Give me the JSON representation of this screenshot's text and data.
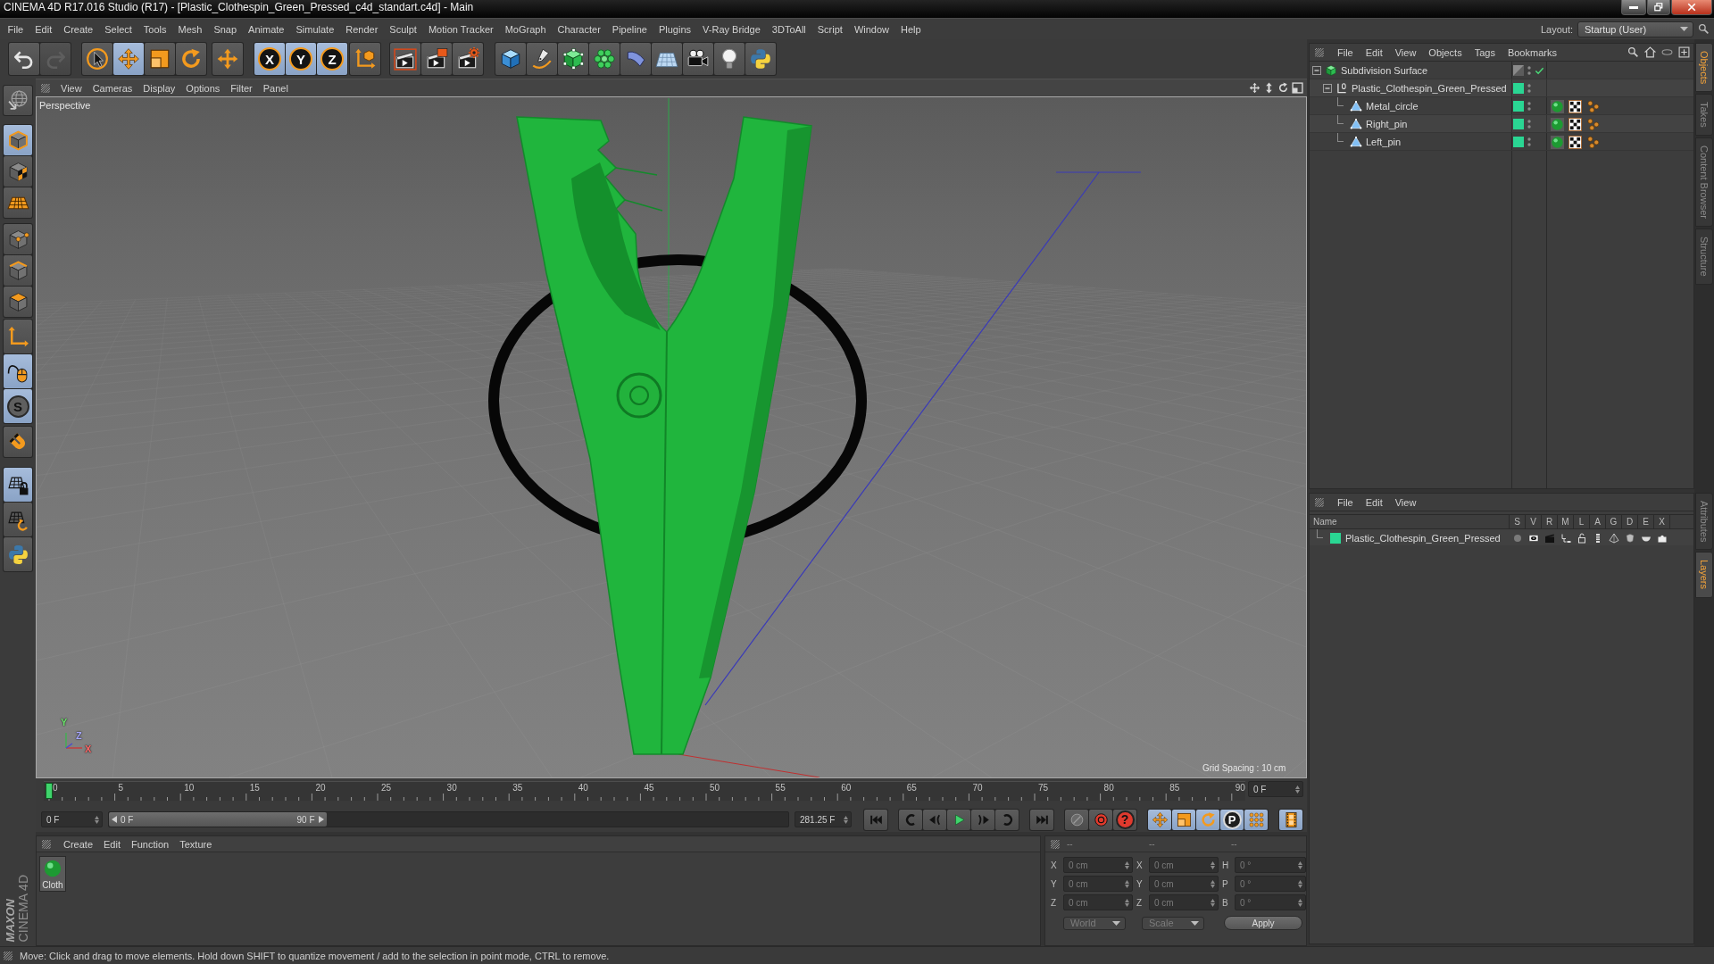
{
  "window": {
    "title": "CINEMA 4D R17.016 Studio (R17) - [Plastic_Clothespin_Green_Pressed_c4d_standart.c4d] - Main"
  },
  "menu_bar": {
    "items": [
      "File",
      "Edit",
      "Create",
      "Select",
      "Tools",
      "Mesh",
      "Snap",
      "Animate",
      "Simulate",
      "Render",
      "Sculpt",
      "Motion Tracker",
      "MoGraph",
      "Character",
      "Pipeline",
      "Plugins",
      "V-Ray Bridge",
      "3DToAll",
      "Script",
      "Window",
      "Help"
    ],
    "layout_label": "Layout:",
    "layout_value": "Startup (User)"
  },
  "toolbar": [
    [
      {
        "kind": "undo",
        "on": false,
        "disabled": false
      },
      {
        "kind": "redo",
        "on": false,
        "disabled": true
      }
    ],
    [
      {
        "kind": "select",
        "on": false,
        "disabled": false
      },
      {
        "kind": "move",
        "on": true,
        "disabled": false
      },
      {
        "kind": "scale",
        "on": false,
        "disabled": false
      },
      {
        "kind": "rotate",
        "on": false,
        "disabled": false
      }
    ],
    [
      {
        "kind": "transform",
        "on": false,
        "disabled": false
      }
    ],
    [
      {
        "kind": "axis",
        "label": "X",
        "on": true,
        "disabled": false
      },
      {
        "kind": "axis",
        "label": "Y",
        "on": true,
        "disabled": false
      },
      {
        "kind": "axis",
        "label": "Z",
        "on": true,
        "disabled": false
      }
    ],
    [
      {
        "kind": "coords",
        "on": false,
        "disabled": false
      }
    ],
    [
      {
        "kind": "render-view",
        "on": false,
        "disabled": false
      },
      {
        "kind": "render-picture",
        "on": false,
        "disabled": false
      },
      {
        "kind": "render-settings",
        "on": false,
        "disabled": false
      }
    ],
    [
      {
        "kind": "cube",
        "on": false,
        "disabled": false
      },
      {
        "kind": "pen",
        "on": false,
        "disabled": false
      },
      {
        "kind": "subdivision",
        "on": false,
        "disabled": false
      },
      {
        "kind": "cloner",
        "on": false,
        "disabled": false
      },
      {
        "kind": "deformer",
        "on": false,
        "disabled": false
      },
      {
        "kind": "floor",
        "on": false,
        "disabled": false
      },
      {
        "kind": "camera",
        "on": false,
        "disabled": false
      },
      {
        "kind": "light",
        "on": false,
        "disabled": false
      },
      {
        "kind": "python",
        "on": false,
        "disabled": false
      }
    ]
  ],
  "tool_strip": [
    [
      {
        "kind": "make-editable",
        "on": false
      }
    ],
    [
      {
        "kind": "model",
        "on": true
      },
      {
        "kind": "texture",
        "on": false
      },
      {
        "kind": "workplane",
        "on": false
      }
    ],
    [
      {
        "kind": "points",
        "on": false
      },
      {
        "kind": "edges",
        "on": false
      },
      {
        "kind": "polygons",
        "on": false
      }
    ],
    [
      {
        "kind": "axis-mode",
        "on": false
      },
      {
        "kind": "tweak",
        "on": true
      },
      {
        "kind": "snap",
        "label": "S",
        "on": true
      }
    ],
    [
      {
        "kind": "magnet",
        "on": false
      }
    ],
    [
      {
        "kind": "workplane-lock",
        "on": true
      },
      {
        "kind": "grid-rotate",
        "on": false
      },
      {
        "kind": "python",
        "on": false
      }
    ]
  ],
  "logo": {
    "brand": "MAXON",
    "product": "CINEMA 4D"
  },
  "viewport": {
    "menu": [
      "View",
      "Cameras",
      "Display",
      "Options",
      "Filter",
      "Panel"
    ],
    "camera": "Perspective",
    "grid_spacing": "Grid Spacing : 10 cm",
    "axes": [
      {
        "label": "Y",
        "color": "#6ee46e"
      },
      {
        "label": "Z",
        "color": "#a8a8ff"
      },
      {
        "label": "X",
        "color": "#ff6a6a"
      }
    ]
  },
  "timeline": {
    "ticks": [
      "0",
      "5",
      "10",
      "15",
      "20",
      "25",
      "30",
      "35",
      "40",
      "45",
      "50",
      "55",
      "60",
      "65",
      "70",
      "75",
      "80",
      "85",
      "90"
    ],
    "level": 0,
    "frame": "0 F",
    "start": "0 F",
    "range": {
      "from": "0 F",
      "to": "90 F",
      "level": 0.32
    },
    "end": "281.25 F",
    "transport": [
      [
        {
          "kind": "start",
          "on": false
        }
      ],
      [
        {
          "kind": "prev-key",
          "on": false
        },
        {
          "kind": "prev-frame",
          "on": false
        },
        {
          "kind": "play",
          "on": false
        },
        {
          "kind": "next-frame",
          "on": false
        },
        {
          "kind": "next-key",
          "on": false
        }
      ],
      [
        {
          "kind": "end",
          "on": false
        }
      ],
      [
        {
          "kind": "record",
          "on": false
        },
        {
          "kind": "autokey",
          "on": false
        },
        {
          "kind": "help",
          "label": "?",
          "on": false
        }
      ],
      [
        {
          "kind": "key-move",
          "on": true
        },
        {
          "kind": "key-scale",
          "on": true
        },
        {
          "kind": "key-rotate",
          "on": true
        },
        {
          "kind": "key-param",
          "label": "P",
          "on": true
        },
        {
          "kind": "key-pla",
          "on": true
        }
      ],
      [
        {
          "kind": "timeline",
          "on": true
        }
      ]
    ]
  },
  "material_manager": {
    "menu": [
      "Create",
      "Edit",
      "Function",
      "Texture"
    ],
    "materials": [
      {
        "name": "Cloth"
      }
    ]
  },
  "coordinates": {
    "headers": [
      "--",
      "--",
      "--"
    ],
    "rows": [
      {
        "label": "X",
        "value": "0 cm",
        "size_label": "X",
        "size": "0 cm",
        "rot_label": "H",
        "rot": "0 °"
      },
      {
        "label": "Y",
        "value": "0 cm",
        "size_label": "Y",
        "size": "0 cm",
        "rot_label": "P",
        "rot": "0 °"
      },
      {
        "label": "Z",
        "value": "0 cm",
        "size_label": "Z",
        "size": "0 cm",
        "rot_label": "B",
        "rot": "0 °"
      }
    ],
    "mode": "World",
    "size_mode": "Scale",
    "apply": "Apply"
  },
  "object_manager": {
    "menu": [
      "File",
      "Edit",
      "View",
      "Objects",
      "Tags",
      "Bookmarks"
    ],
    "tree": [
      {
        "name": "Subdivision Surface",
        "kind": "generator",
        "expanded": true,
        "enabled": true,
        "children": [
          {
            "name": "Plastic_Clothespin_Green_Pressed",
            "kind": "null",
            "expanded": true,
            "color": "#2ad693",
            "children": [
              {
                "name": "Metal_circle",
                "kind": "polygon",
                "color": "#2ad693",
                "tags": [
                  {
                    "kind": "material"
                  },
                  {
                    "kind": "uvw"
                  },
                  {
                    "kind": "selection"
                  }
                ]
              },
              {
                "name": "Right_pin",
                "kind": "polygon",
                "color": "#2ad693",
                "tags": [
                  {
                    "kind": "material"
                  },
                  {
                    "kind": "uvw"
                  },
                  {
                    "kind": "selection"
                  }
                ]
              },
              {
                "name": "Left_pin",
                "kind": "polygon",
                "color": "#2ad693",
                "tags": [
                  {
                    "kind": "material"
                  },
                  {
                    "kind": "uvw"
                  },
                  {
                    "kind": "selection"
                  }
                ]
              }
            ]
          }
        ]
      }
    ]
  },
  "layer_manager": {
    "menu": [
      "File",
      "Edit",
      "View"
    ],
    "columns": [
      "Name",
      "S",
      "V",
      "R",
      "M",
      "L",
      "A",
      "G",
      "D",
      "E",
      "X"
    ],
    "layers": [
      {
        "name": "Plastic_Clothespin_Green_Pressed",
        "color": "#2ad693",
        "flags": [
          {
            "kind": "solo"
          },
          {
            "kind": "view"
          },
          {
            "kind": "render"
          },
          {
            "kind": "manager"
          },
          {
            "kind": "lock"
          },
          {
            "kind": "animation"
          },
          {
            "kind": "generators"
          },
          {
            "kind": "deformers"
          },
          {
            "kind": "expressions"
          },
          {
            "kind": "xref"
          }
        ]
      }
    ]
  },
  "side_tabs": [
    [
      {
        "label": "Objects",
        "selected": true
      },
      {
        "label": "Takes",
        "selected": false
      },
      {
        "label": "Content Browser",
        "selected": false
      },
      {
        "label": "Structure",
        "selected": false
      }
    ],
    [
      {
        "label": "Attributes",
        "selected": false
      },
      {
        "label": "Layers",
        "selected": true
      }
    ]
  ],
  "status_bar": {
    "text": "Move: Click and drag to move elements. Hold down SHIFT to quantize movement / add to the selection in point mode, CTRL to remove."
  }
}
